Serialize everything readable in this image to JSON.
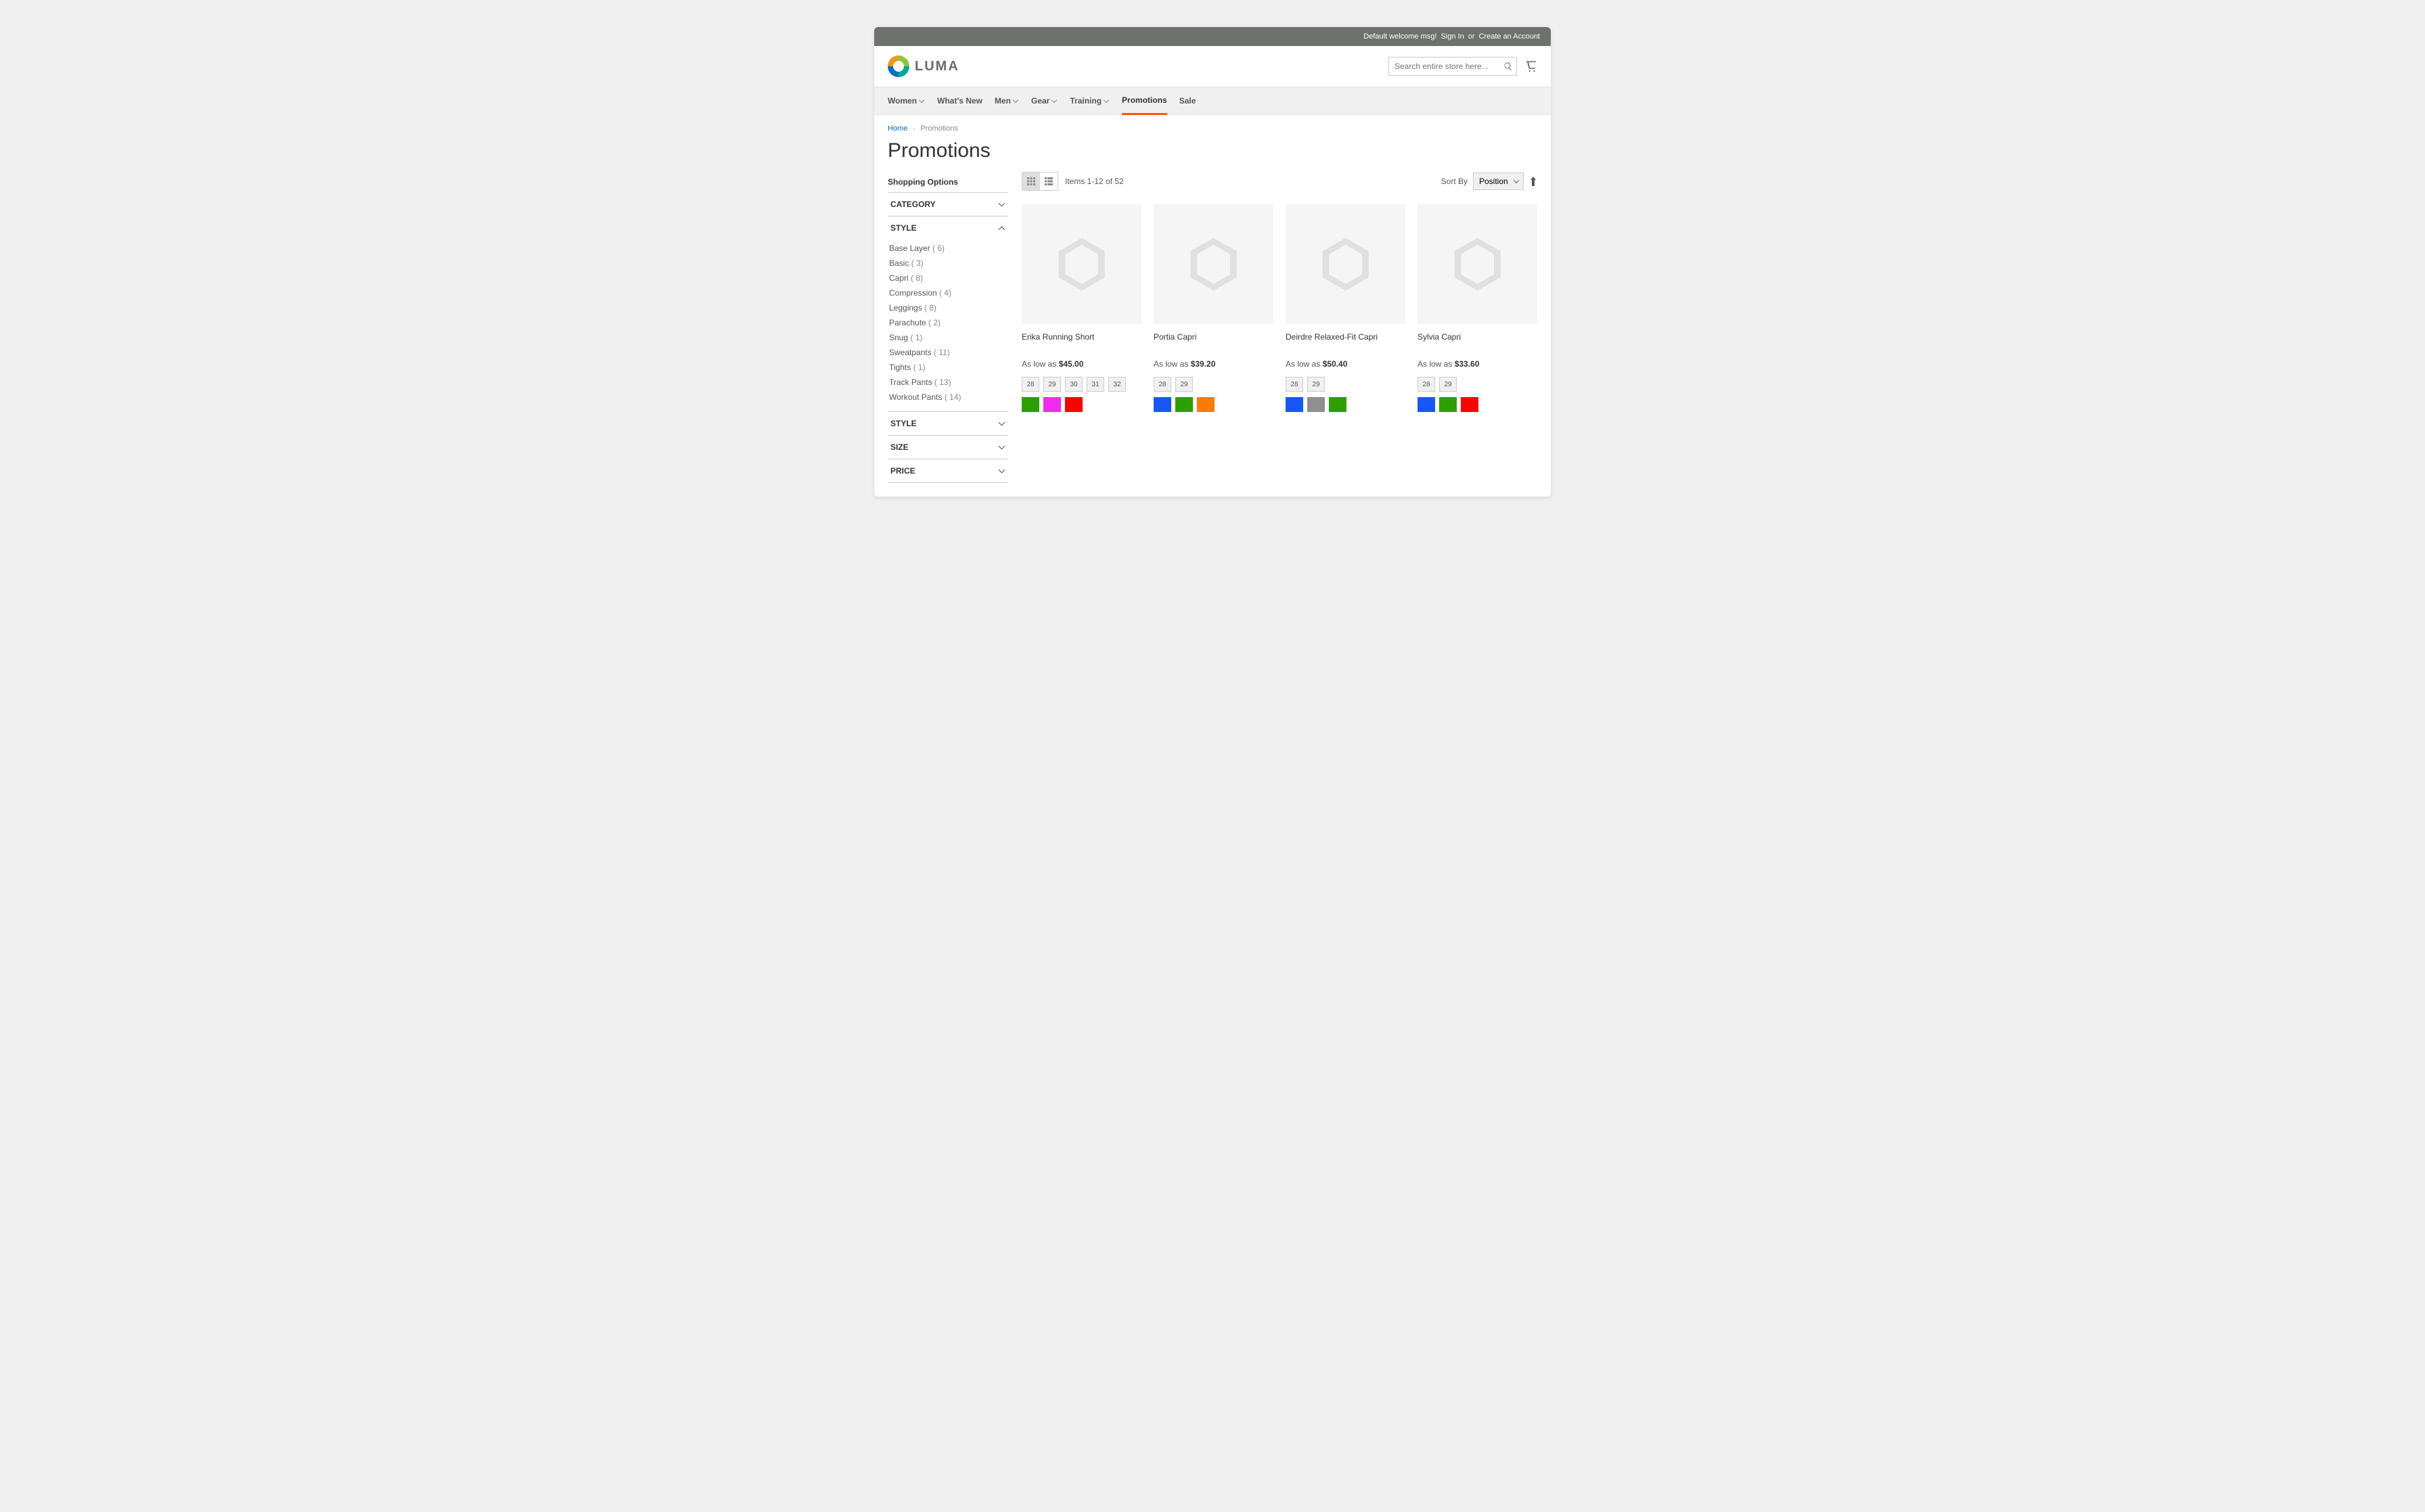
{
  "topbar": {
    "welcome": "Default welcome msg!",
    "signin": "Sign In",
    "or": "or",
    "create": "Create an Account"
  },
  "logo_text": "LUMA",
  "search": {
    "placeholder": "Search entire store here..."
  },
  "nav": {
    "items": [
      {
        "label": "Women",
        "hasChev": true
      },
      {
        "label": "What's New",
        "hasChev": false
      },
      {
        "label": "Men",
        "hasChev": true
      },
      {
        "label": "Gear",
        "hasChev": true
      },
      {
        "label": "Training",
        "hasChev": true
      },
      {
        "label": "Promotions",
        "hasChev": false,
        "active": true
      },
      {
        "label": "Sale",
        "hasChev": false
      }
    ]
  },
  "breadcrumbs": {
    "home": "Home",
    "current": "Promotions"
  },
  "page_title": "Promotions",
  "sidebar": {
    "heading": "Shopping Options",
    "sections": [
      {
        "title": "CATEGORY",
        "open": false
      },
      {
        "title": "STYLE",
        "open": true,
        "options": [
          {
            "label": "Base Layer",
            "count": 6
          },
          {
            "label": "Basic",
            "count": 3
          },
          {
            "label": "Capri",
            "count": 8
          },
          {
            "label": "Compression",
            "count": 4
          },
          {
            "label": "Leggings",
            "count": 8
          },
          {
            "label": "Parachute",
            "count": 2
          },
          {
            "label": "Snug",
            "count": 1
          },
          {
            "label": "Sweatpants",
            "count": 11
          },
          {
            "label": "Tights",
            "count": 1
          },
          {
            "label": "Track Pants",
            "count": 13
          },
          {
            "label": "Workout Pants",
            "count": 14
          }
        ]
      },
      {
        "title": "STYLE",
        "open": false
      },
      {
        "title": "SIZE",
        "open": false
      },
      {
        "title": "PRICE",
        "open": false
      }
    ]
  },
  "toolbar": {
    "count_text": "Items 1-12 of 52",
    "sort_label": "Sort By",
    "sort_value": "Position"
  },
  "low_as": "As low as",
  "products": [
    {
      "name": "Erika Running Short",
      "price": "$45.00",
      "sizes": [
        "28",
        "29",
        "30",
        "31",
        "32"
      ],
      "colors": [
        "#2d9f00",
        "#ef2cec",
        "#ff0000"
      ]
    },
    {
      "name": "Portia Capri",
      "price": "$39.20",
      "sizes": [
        "28",
        "29"
      ],
      "colors": [
        "#1857f7",
        "#2d9f00",
        "#ff7b00"
      ]
    },
    {
      "name": "Deirdre Relaxed-Fit Capri",
      "price": "$50.40",
      "sizes": [
        "28",
        "29"
      ],
      "colors": [
        "#1857f7",
        "#8f8f8f",
        "#2d9f00"
      ]
    },
    {
      "name": "Sylvia Capri",
      "price": "$33.60",
      "sizes": [
        "28",
        "29"
      ],
      "colors": [
        "#1857f7",
        "#2d9f00",
        "#ff0000"
      ]
    }
  ]
}
